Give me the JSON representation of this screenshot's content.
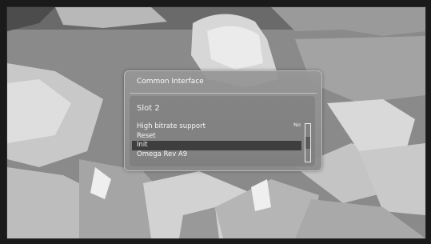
{
  "dialog": {
    "title": "Common Interface",
    "slot_title": "Slot 2",
    "items": [
      {
        "label": "High bitrate support",
        "value": "No"
      },
      {
        "label": "Reset",
        "value": ""
      },
      {
        "label": "Init",
        "value": ""
      },
      {
        "label": "Omega Rev A9",
        "value": ""
      }
    ],
    "selected_index": 2
  }
}
